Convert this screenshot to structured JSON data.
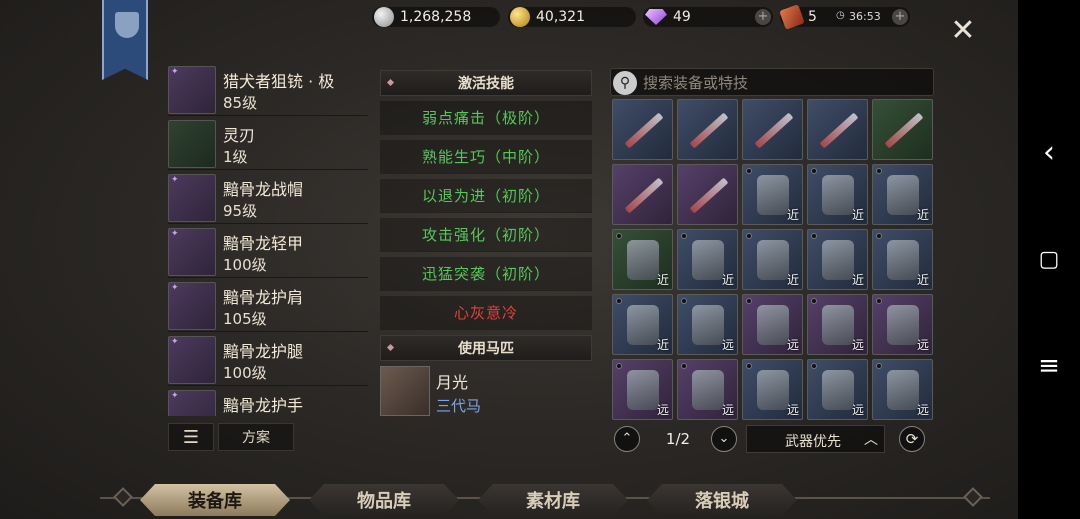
{
  "currencies": [
    {
      "icon": "silver-coin-icon",
      "value": "1,268,258"
    },
    {
      "icon": "gold-coin-icon",
      "value": "40,321"
    },
    {
      "icon": "diamond-icon",
      "value": "49"
    },
    {
      "icon": "ticket-icon",
      "value": "5",
      "timer": "36:53"
    }
  ],
  "plus": "+",
  "close": "✕",
  "equipped": [
    {
      "name": "猎犬者狙铳 · 极",
      "level": "85级",
      "rarity": "purple"
    },
    {
      "name": "灵刃",
      "level": "1级",
      "rarity": "green"
    },
    {
      "name": "黯骨龙战帽",
      "level": "95级",
      "rarity": "purple"
    },
    {
      "name": "黯骨龙轻甲",
      "level": "100级",
      "rarity": "purple"
    },
    {
      "name": "黯骨龙护肩",
      "level": "105级",
      "rarity": "purple"
    },
    {
      "name": "黯骨龙护腿",
      "level": "100级",
      "rarity": "purple"
    },
    {
      "name": "黯骨龙护手",
      "level": "",
      "rarity": "purple"
    }
  ],
  "list_buttons": {
    "menu": "☰",
    "plan": "方案"
  },
  "skills_header": "激活技能",
  "skills": [
    {
      "text": "弱点痛击（极阶）",
      "color": "#57c75a"
    },
    {
      "text": "熟能生巧（中阶）",
      "color": "#57c75a"
    },
    {
      "text": "以退为进（初阶）",
      "color": "#57c75a"
    },
    {
      "text": "攻击强化（初阶）",
      "color": "#57c75a"
    },
    {
      "text": "迅猛突袭（初阶）",
      "color": "#57c75a"
    },
    {
      "text": "心灰意冷",
      "color": "#e0423a"
    }
  ],
  "horse_header": "使用马匹",
  "horse": {
    "name": "月光",
    "generation": "三代马"
  },
  "search": {
    "placeholder": "搜索装备或特技",
    "icon": "search-icon"
  },
  "inventory": [
    {
      "bg": "blue",
      "type": "w",
      "tag": ""
    },
    {
      "bg": "blue",
      "type": "w",
      "tag": ""
    },
    {
      "bg": "blue",
      "type": "w",
      "tag": ""
    },
    {
      "bg": "blue",
      "type": "w",
      "tag": ""
    },
    {
      "bg": "green",
      "type": "w",
      "tag": ""
    },
    {
      "bg": "purple",
      "type": "w",
      "tag": ""
    },
    {
      "bg": "purple",
      "type": "w",
      "tag": ""
    },
    {
      "bg": "blue",
      "type": "a",
      "tag": "近",
      "dot": true
    },
    {
      "bg": "blue",
      "type": "a",
      "tag": "近",
      "dot": true
    },
    {
      "bg": "blue",
      "type": "a",
      "tag": "近",
      "dot": true
    },
    {
      "bg": "green",
      "type": "a",
      "tag": "近",
      "dot": true
    },
    {
      "bg": "blue",
      "type": "a",
      "tag": "近",
      "dot": true
    },
    {
      "bg": "blue",
      "type": "a",
      "tag": "近",
      "dot": true
    },
    {
      "bg": "blue",
      "type": "a",
      "tag": "近",
      "dot": true
    },
    {
      "bg": "blue",
      "type": "a",
      "tag": "近",
      "dot": true
    },
    {
      "bg": "blue",
      "type": "a",
      "tag": "近",
      "dot": true
    },
    {
      "bg": "blue",
      "type": "a",
      "tag": "远",
      "dot": true
    },
    {
      "bg": "purple",
      "type": "a",
      "tag": "远",
      "dot": true
    },
    {
      "bg": "purple",
      "type": "a",
      "tag": "远",
      "dot": true
    },
    {
      "bg": "purple",
      "type": "a",
      "tag": "远",
      "dot": true
    },
    {
      "bg": "purple",
      "type": "a",
      "tag": "远",
      "dot": true
    },
    {
      "bg": "purple",
      "type": "a",
      "tag": "远",
      "dot": true
    },
    {
      "bg": "blue",
      "type": "a",
      "tag": "远",
      "dot": true
    },
    {
      "bg": "blue",
      "type": "a",
      "tag": "远",
      "dot": true
    },
    {
      "bg": "blue",
      "type": "a",
      "tag": "远",
      "dot": true
    }
  ],
  "pager": {
    "up": "⌃",
    "down": "⌄",
    "page": "1/2",
    "sort": "武器优先",
    "sort_caret": "︿",
    "refresh": "⟳"
  },
  "tabs": [
    "装备库",
    "物品库",
    "素材库",
    "落银城"
  ],
  "active_tab": 0,
  "nav": {
    "back": "‹",
    "home": "▢",
    "menu": "≡"
  }
}
